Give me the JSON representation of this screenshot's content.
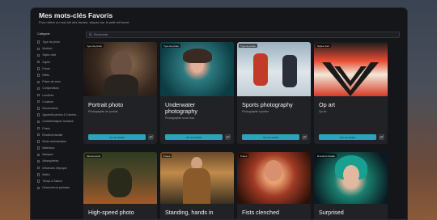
{
  "window": {
    "title": "Mes mots-clés Favoris",
    "subtitle": "Pour retirer un mot-clé des favoris, cliquez sur le petit reil barré."
  },
  "sidebar": {
    "heading": "Catégorie",
    "items": [
      "Type de photo",
      "Medium",
      "Styles d'art",
      "Sujets",
      "Fonds",
      "Effets",
      "Prises de vues",
      "Compositions",
      "Lumières",
      "Couleurs",
      "Mouvements",
      "Appareils photos & Caméra...",
      "Caractéristiques humaine",
      "Poses",
      "Émotions faciale",
      "Mode vestimentaire",
      "Matériaux",
      "Marques",
      "Atmosphères",
      "Influences d'époque",
      "Météo",
      "Temps & Saison",
      "Décennies et périodes"
    ]
  },
  "search": {
    "placeholder": "Rechercher"
  },
  "cards": [
    {
      "badge": "Type de photo",
      "title": "Portrait photo",
      "subtitle": "Photographie de portrait",
      "button": "Voir les détails"
    },
    {
      "badge": "Type de photo",
      "title": "Underwater photography",
      "subtitle": "Photographie sous l'eau",
      "button": "Voir les détails"
    },
    {
      "badge": "Type de photo",
      "title": "Sports photography",
      "subtitle": "Photographie sportive",
      "button": "Voir les détails"
    },
    {
      "badge": "Styles d'art",
      "title": "Op art",
      "subtitle": "Op art",
      "button": "Voir les détails"
    },
    {
      "badge": "Mouvements",
      "title": "High-speed photo"
    },
    {
      "badge": "Poses",
      "title": "Standing, hands in"
    },
    {
      "badge": "Poses",
      "title": "Fists clenched"
    },
    {
      "badge": "Émotions faciale",
      "title": "Surprised"
    }
  ]
}
